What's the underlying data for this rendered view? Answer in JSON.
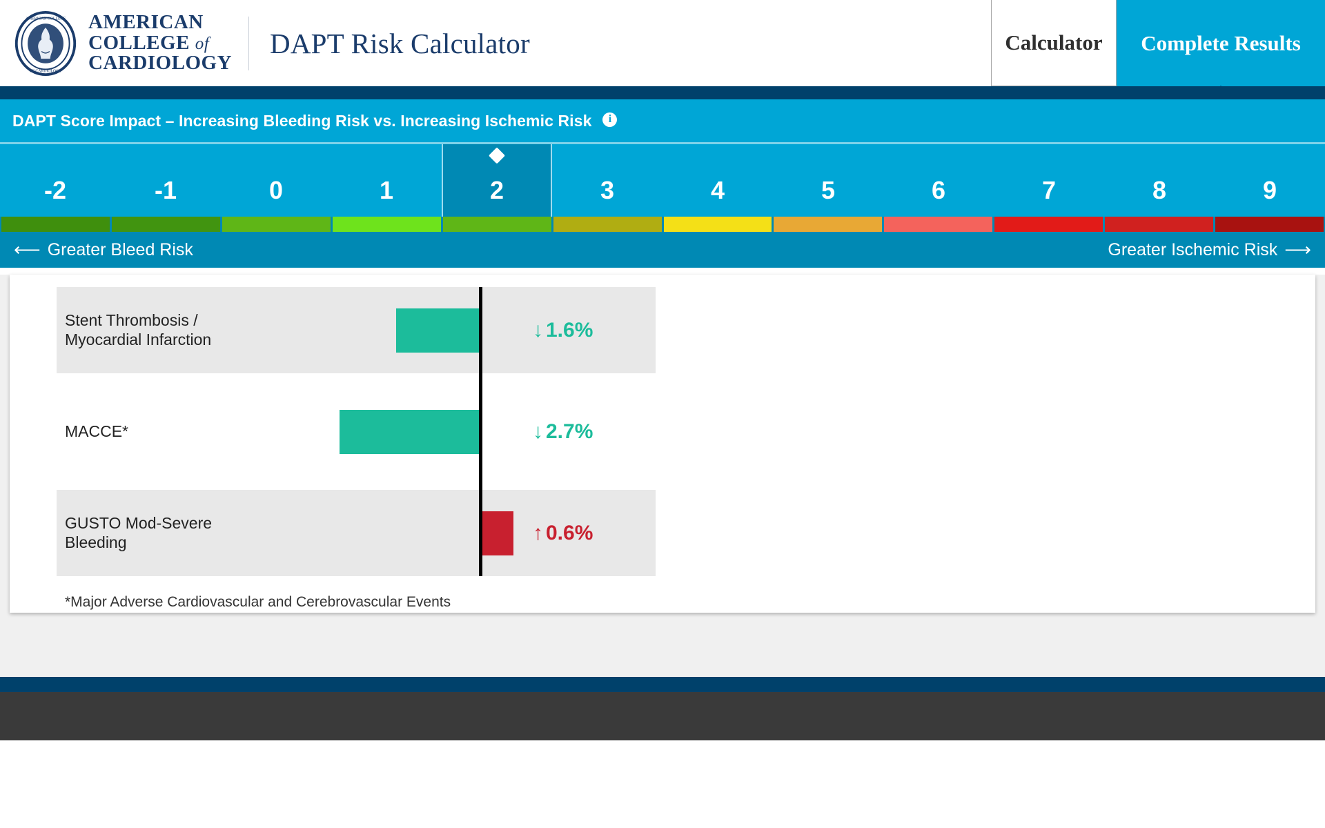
{
  "header": {
    "org_line1": "AMERICAN",
    "org_line2_a": "COLLEGE",
    "org_line2_b": "of",
    "org_line3": "CARDIOLOGY",
    "app_title": "DAPT Risk Calculator",
    "seal_icon": "acc-seal-icon",
    "tabs": [
      {
        "label": "Calculator",
        "active": false
      },
      {
        "label": "Complete Results",
        "active": true
      }
    ]
  },
  "score_banner": {
    "title": "DAPT Score Impact – Increasing Bleeding Risk vs. Increasing Ischemic Risk",
    "info_icon": "info-icon",
    "info_glyph": "i"
  },
  "scale": {
    "values": [
      "-2",
      "-1",
      "0",
      "1",
      "2",
      "3",
      "4",
      "5",
      "6",
      "7",
      "8",
      "9"
    ],
    "selected_value": "2",
    "marker_icon": "diamond-marker-icon",
    "segment_colors": [
      "#3f8f0d",
      "#419410",
      "#5fb617",
      "#6ee31c",
      "#5fb617",
      "#b0ad12",
      "#f4e017",
      "#e8a835",
      "#f4635c",
      "#e21b18",
      "#d0211f",
      "#a81210"
    ],
    "left_label": "Greater Bleed Risk",
    "left_arrow": "⟵",
    "right_label": "Greater Ischemic Risk",
    "right_arrow": "⟶"
  },
  "chart_data": {
    "type": "bar",
    "title": "DAPT Score Impact",
    "orientation": "horizontal",
    "zero_line": true,
    "grid": false,
    "categories": [
      "Stent Thrombosis /\nMyocardial Infarction",
      "MACCE*",
      "GUSTO Mod-Severe\nBleeding"
    ],
    "values": [
      -1.6,
      -2.7,
      0.6
    ],
    "value_labels": [
      "1.6%",
      "2.7%",
      "0.6%"
    ],
    "direction_arrows": [
      "↓",
      "↓",
      "↑"
    ],
    "bar_colors": [
      "#1cbc9b",
      "#1cbc9b",
      "#c8202f"
    ],
    "value_colors": [
      "#1cbc9b",
      "#1cbc9b",
      "#c8202f"
    ],
    "row_backgrounds": [
      "#e8e8e8",
      "#ffffff",
      "#e8e8e8"
    ],
    "xlabel": "",
    "ylabel": ""
  },
  "footnote": "*Major Adverse Cardiovascular and Cerebrovascular Events"
}
